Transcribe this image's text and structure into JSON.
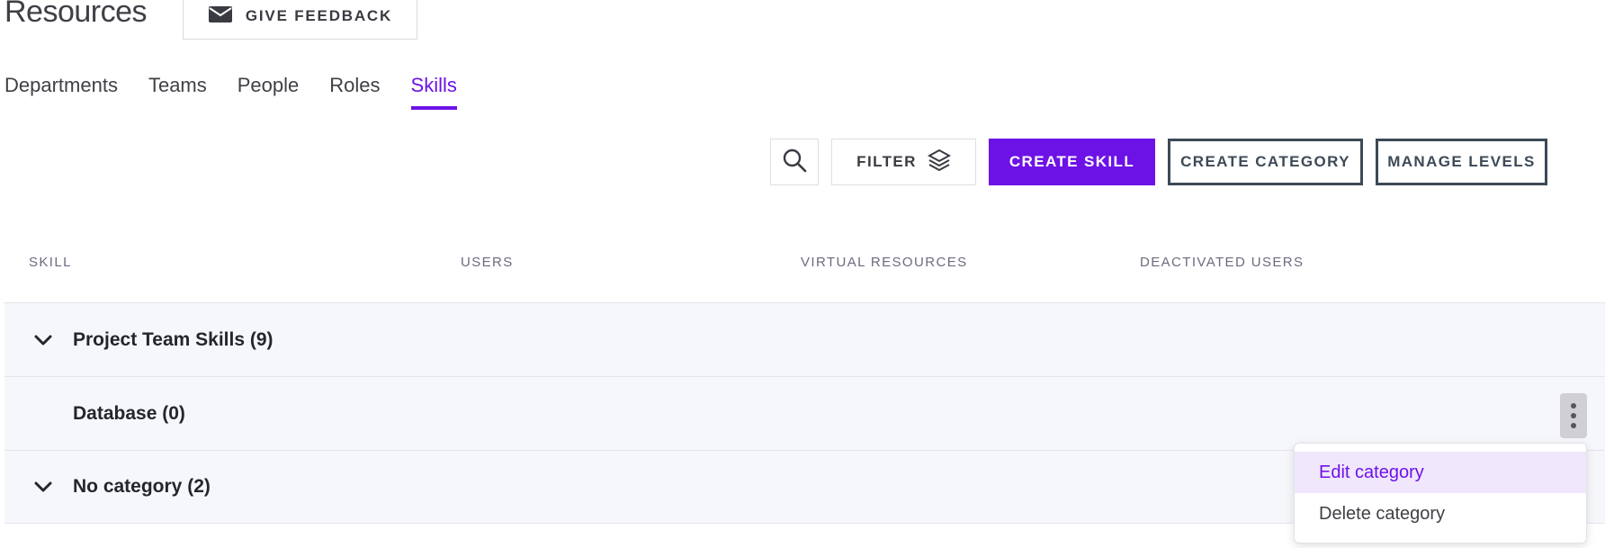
{
  "header": {
    "title": "Resources",
    "feedback_label": "GIVE FEEDBACK"
  },
  "tabs": [
    {
      "label": "Departments",
      "active": false
    },
    {
      "label": "Teams",
      "active": false
    },
    {
      "label": "People",
      "active": false
    },
    {
      "label": "Roles",
      "active": false
    },
    {
      "label": "Skills",
      "active": true
    }
  ],
  "toolbar": {
    "search_icon": "search-icon",
    "filter_label": "FILTER",
    "filter_icon": "layers-icon",
    "create_skill_label": "CREATE SKILL",
    "create_category_label": "CREATE CATEGORY",
    "manage_levels_label": "MANAGE LEVELS"
  },
  "table": {
    "columns": [
      "SKILL",
      "USERS",
      "VIRTUAL RESOURCES",
      "DEACTIVATED USERS"
    ],
    "rows": [
      {
        "label": "Project Team Skills (9)",
        "expandable": true
      },
      {
        "label": "Database (0)",
        "expandable": false,
        "has_menu": true
      },
      {
        "label": "No category (2)",
        "expandable": true
      }
    ]
  },
  "context_menu": {
    "items": [
      {
        "label": "Edit category",
        "highlighted": true
      },
      {
        "label": "Delete category",
        "highlighted": false
      }
    ]
  },
  "colors": {
    "accent": "#6d12e6",
    "outline": "#3d4a57",
    "row_bg": "#f6f7fa"
  }
}
